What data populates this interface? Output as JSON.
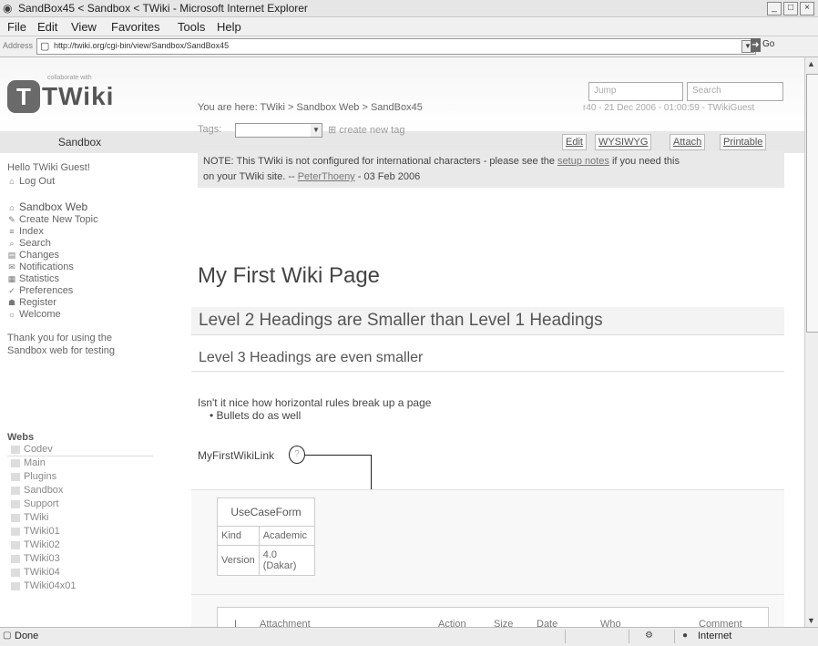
{
  "window": {
    "title": "SandBox45 < Sandbox < TWiki - Microsoft Internet Explorer",
    "menu": [
      "File",
      "Edit",
      "View",
      "Favorites",
      "Tools",
      "Help"
    ]
  },
  "address": {
    "label": "Address",
    "url": "http://twiki.org/cgi-bin/view/Sandbox/SandBox45",
    "go": "Go"
  },
  "header": {
    "logo_letter": "T",
    "logo_text": "TWiki",
    "logo_tagline": "collaborate with",
    "jump_placeholder": "Jump",
    "search_placeholder": "Search"
  },
  "sidebar": {
    "web_title": "Sandbox",
    "greeting": "Hello TWiki Guest!",
    "logout": "Log Out",
    "nav": [
      {
        "icon": "home-icon",
        "label": "Sandbox Web"
      },
      {
        "icon": "new-topic-icon",
        "label": "Create New Topic"
      },
      {
        "icon": "index-icon",
        "label": "Index"
      },
      {
        "icon": "search-icon",
        "label": "Search"
      },
      {
        "icon": "changes-icon",
        "label": "Changes"
      },
      {
        "icon": "notifications-icon",
        "label": "Notifications"
      },
      {
        "icon": "statistics-icon",
        "label": "Statistics"
      },
      {
        "icon": "preferences-icon",
        "label": "Preferences"
      },
      {
        "icon": "register-icon",
        "label": "Register"
      },
      {
        "icon": "welcome-icon",
        "label": "Welcome"
      }
    ],
    "thanks": [
      "Thank you for using the",
      "Sandbox web for testing"
    ],
    "webs_title": "Webs",
    "webs": [
      "Codev",
      "Main",
      "Plugins",
      "Sandbox",
      "Support",
      "TWiki",
      "TWiki01",
      "TWiki02",
      "TWiki03",
      "TWiki04",
      "TWiki04x01"
    ]
  },
  "topbar": {
    "buttons": [
      "Edit",
      "WYSIWYG",
      "Attach",
      "Printable"
    ]
  },
  "page": {
    "breadcrumb": "You are here: TWiki > Sandbox Web > SandBox45",
    "revision": "r40 - 21 Dec 2006 - 01:00:59 - TWikiGuest",
    "tags_label": "Tags:",
    "create_tag": "create new tag",
    "note_text": "NOTE: This TWiki is not configured for international characters - please see the ",
    "note_link": "setup notes",
    "note_text2": " if you need this",
    "note_line2": "on your TWiki site. -- ",
    "note_author": "PeterThoeny",
    "note_date": " - 03 Feb 2006",
    "h1": "My First Wiki Page",
    "h2": "Level 2 Headings are Smaller than Level 1 Headings",
    "h3": "Level 3 Headings are even smaller",
    "para": "Isn't it nice how horizontal rules break up a page",
    "bullet": "Bullets do as well",
    "wikilink": "MyFirstWikiLink",
    "wikilink_q": "?",
    "form": {
      "title": "UseCaseForm",
      "rows": [
        {
          "label": "Kind",
          "value": "Academic"
        },
        {
          "label": "Version",
          "value": "4.0 (Dakar)"
        }
      ]
    },
    "attachments_headers": [
      "I",
      "Attachment",
      "Action",
      "Size",
      "Date",
      "Who",
      "Comment"
    ]
  },
  "status": {
    "text": "Done",
    "zone": "Internet"
  }
}
